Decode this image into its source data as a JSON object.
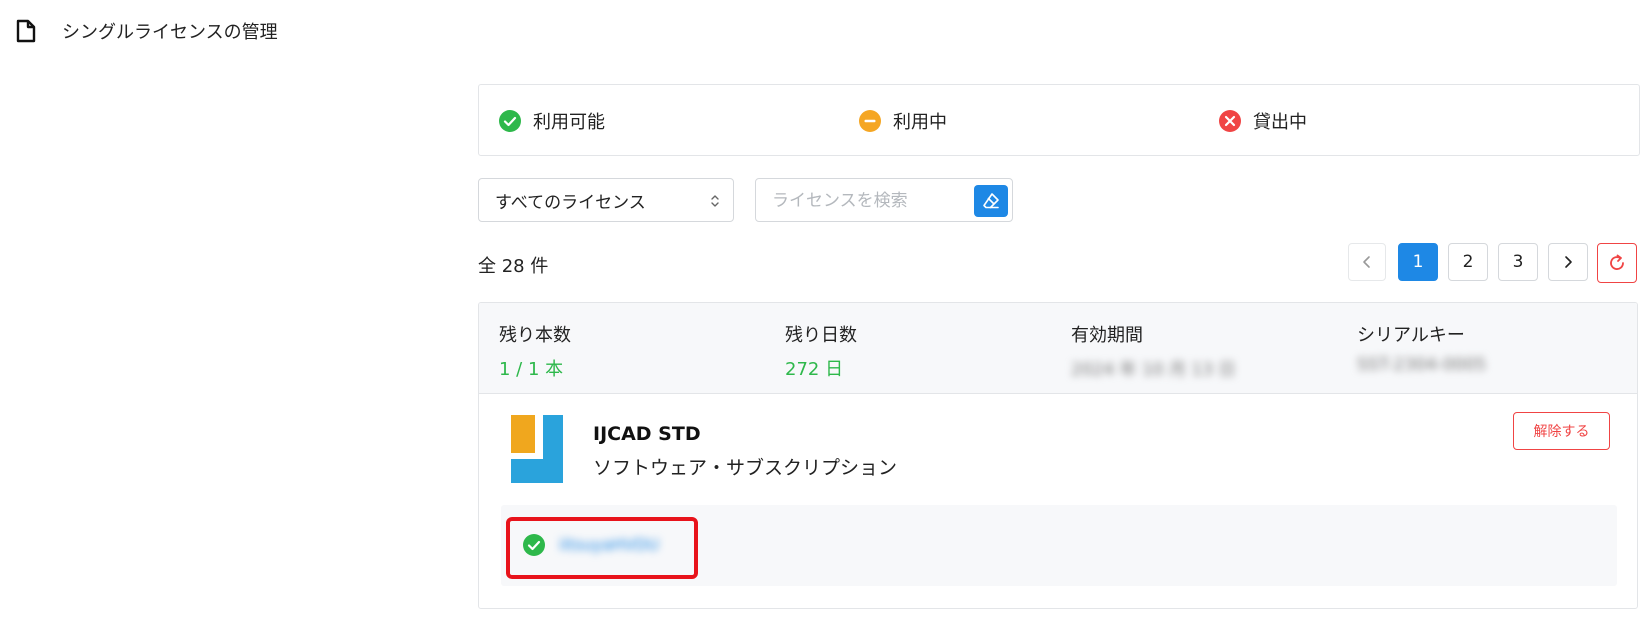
{
  "header": {
    "title": "シングルライセンスの管理",
    "icon": "document-icon"
  },
  "legend": {
    "available": {
      "label": "利用可能",
      "icon": "check-circle-icon",
      "color": "#2eb84b"
    },
    "in_use": {
      "label": "利用中",
      "icon": "minus-circle-icon",
      "color": "#f5a623"
    },
    "lent_out": {
      "label": "貸出中",
      "icon": "x-circle-icon",
      "color": "#f04444"
    }
  },
  "filter": {
    "select_value": "すべてのライセンス",
    "search_placeholder": "ライセンスを検索",
    "search_value": ""
  },
  "total_label": "全 28 件",
  "pagination": {
    "pages": [
      "1",
      "2",
      "3"
    ],
    "current": "1"
  },
  "license": {
    "stats": {
      "remaining_count_label": "残り本数",
      "remaining_count_value": "1 / 1 本",
      "remaining_days_label": "残り日数",
      "remaining_days_value": "272 日",
      "validity_label": "有効期間",
      "validity_value": "2024 年 10 月 13 日",
      "serial_label": "シリアルキー",
      "serial_value": "SST-2304-0005"
    },
    "product_name": "IJCAD STD",
    "product_type": "ソフトウェア・サブスクリプション",
    "release_label": "解除する",
    "user": {
      "name": "iitsuyaHVDU",
      "status_icon": "check-circle-icon"
    }
  },
  "colors": {
    "accent": "#1e88e5",
    "green": "#2eb84b",
    "danger": "#f04444",
    "amber": "#f5a623"
  }
}
